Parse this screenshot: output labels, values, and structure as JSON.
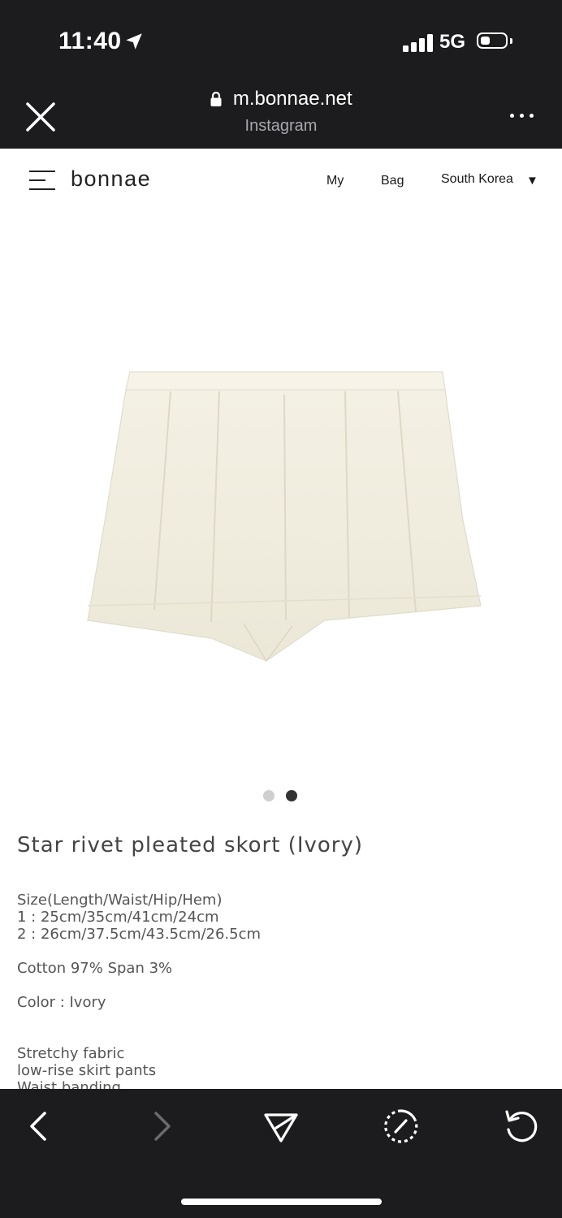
{
  "status_bar": {
    "time": "11:40",
    "network": "5G",
    "icons": [
      "location-arrow-icon",
      "signal-icon",
      "battery-icon"
    ]
  },
  "browser": {
    "url": "m.bonnae.net",
    "source": "Instagram",
    "icons": [
      "close-icon",
      "lock-icon",
      "more-icon"
    ]
  },
  "site_header": {
    "logo": "bonnae",
    "nav": {
      "my": "My",
      "bag": "Bag",
      "country": "South Korea",
      "caret": "▼"
    },
    "icons": [
      "menu-icon"
    ]
  },
  "carousel": {
    "current_index": 2,
    "total": 2,
    "colors": {
      "inactive": "#cfcfcf",
      "active": "#333333"
    }
  },
  "product": {
    "title": "Star rivet pleated skort (Ivory)",
    "size_heading": "Size(Length/Waist/Hip/Hem)",
    "size_1": "1 : 25cm/35cm/41cm/24cm",
    "size_2": "2 : 26cm/37.5cm/43.5cm/26.5cm",
    "material": "Cotton 97% Span 3%",
    "color": "Color : Ivory",
    "feature_1": "Stretchy fabric",
    "feature_2": "low-rise skirt pants",
    "feature_3": "Waist banding"
  },
  "bottom_toolbar": {
    "icons": [
      "back-icon",
      "forward-icon",
      "share-icon",
      "speed-icon",
      "refresh-icon"
    ]
  },
  "colors": {
    "bar_bg": "#1c1c1e",
    "text": "#444444",
    "garment": "#f1eee0"
  }
}
